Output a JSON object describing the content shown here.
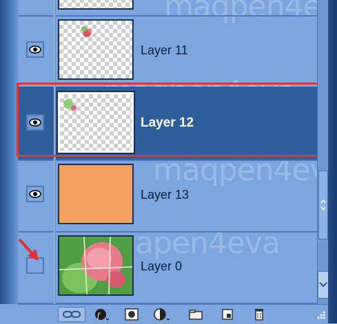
{
  "layers": [
    {
      "name": "Layer 11",
      "visible": true,
      "selected": false,
      "thumbnail": "transparent-with-flower-top-left"
    },
    {
      "name": "Layer 12",
      "visible": true,
      "selected": true,
      "thumbnail": "transparent-with-leaf-top-left"
    },
    {
      "name": "Layer 13",
      "visible": true,
      "selected": false,
      "thumbnail": "solid-orange"
    },
    {
      "name": "Layer 0",
      "visible": false,
      "selected": false,
      "thumbnail": "rose-photo"
    }
  ],
  "watermark": {
    "text1": "maqpen4eva",
    "text2": "maqpen4eva",
    "text3": "maqpen4eva",
    "text4": "maqpen4eva",
    "text5": "apen4eva"
  },
  "colors": {
    "panel": "#7ea6de",
    "selected_row": "#2f5d9a",
    "highlight_frame": "#d83a3a",
    "arrow": "#e03030",
    "orange_fill": "#f3a060"
  },
  "toolbar_icons": [
    "link-layers-icon",
    "layer-style-icon",
    "layer-mask-icon",
    "adjustment-layer-icon",
    "new-group-icon",
    "new-layer-icon",
    "trash-icon"
  ]
}
